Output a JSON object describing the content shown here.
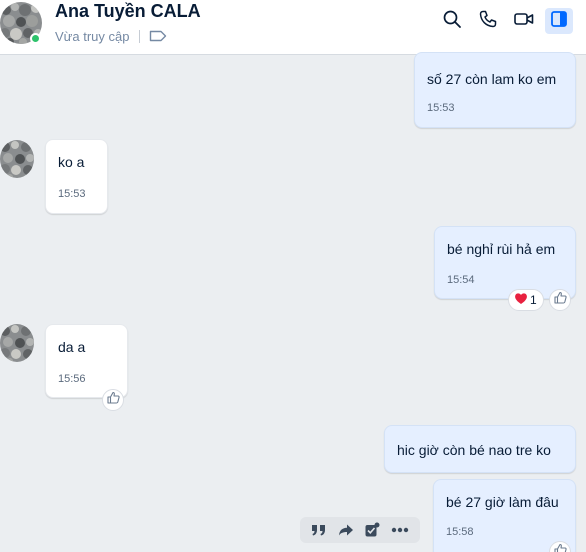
{
  "header": {
    "contact_name": "Ana Tuyền CALA",
    "status": "Vừa truy cập",
    "icons": [
      "search-icon",
      "phone-icon",
      "video-call-icon",
      "sidebar-toggle-icon"
    ],
    "active_color": "#0068ff",
    "online_color": "#2dc26b"
  },
  "messages": [
    {
      "from": "me",
      "text": "số 27 còn lam ko em",
      "time": "15:53"
    },
    {
      "from": "them",
      "text": "ko a",
      "time": "15:53"
    },
    {
      "from": "me",
      "text": "bé nghỉ rùi hả em",
      "time": "15:54",
      "reaction": {
        "icon": "heart-icon",
        "count": "1"
      }
    },
    {
      "from": "them",
      "text": "da a",
      "time": "15:56"
    },
    {
      "from": "me",
      "text": "hic giờ còn bé nao tre ko",
      "time": ""
    },
    {
      "from": "me",
      "text": "bé 27 giờ làm đâu",
      "time": "15:58"
    }
  ],
  "hover_actions": [
    "quote-icon",
    "forward-icon",
    "task-icon",
    "more-icon"
  ],
  "colors": {
    "me_bubble": "#e5efff",
    "them_bubble": "#ffffff",
    "chat_background": "#ebeef1",
    "heart": "#e8213f"
  }
}
